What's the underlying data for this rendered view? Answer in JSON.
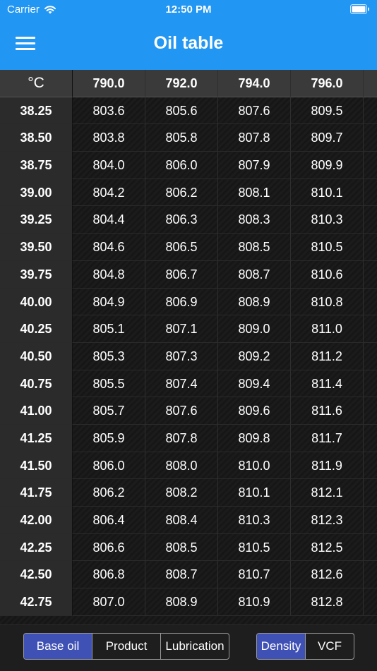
{
  "status": {
    "carrier": "Carrier",
    "time": "12:50 PM"
  },
  "header": {
    "title": "Oil table"
  },
  "table": {
    "corner": "°C",
    "columns": [
      "790.0",
      "792.0",
      "794.0",
      "796.0"
    ],
    "rows": [
      {
        "t": "38.25",
        "v": [
          "803.6",
          "805.6",
          "807.6",
          "809.5"
        ]
      },
      {
        "t": "38.50",
        "v": [
          "803.8",
          "805.8",
          "807.8",
          "809.7"
        ]
      },
      {
        "t": "38.75",
        "v": [
          "804.0",
          "806.0",
          "807.9",
          "809.9"
        ]
      },
      {
        "t": "39.00",
        "v": [
          "804.2",
          "806.2",
          "808.1",
          "810.1"
        ]
      },
      {
        "t": "39.25",
        "v": [
          "804.4",
          "806.3",
          "808.3",
          "810.3"
        ]
      },
      {
        "t": "39.50",
        "v": [
          "804.6",
          "806.5",
          "808.5",
          "810.5"
        ]
      },
      {
        "t": "39.75",
        "v": [
          "804.8",
          "806.7",
          "808.7",
          "810.6"
        ]
      },
      {
        "t": "40.00",
        "v": [
          "804.9",
          "806.9",
          "808.9",
          "810.8"
        ]
      },
      {
        "t": "40.25",
        "v": [
          "805.1",
          "807.1",
          "809.0",
          "811.0"
        ]
      },
      {
        "t": "40.50",
        "v": [
          "805.3",
          "807.3",
          "809.2",
          "811.2"
        ]
      },
      {
        "t": "40.75",
        "v": [
          "805.5",
          "807.4",
          "809.4",
          "811.4"
        ]
      },
      {
        "t": "41.00",
        "v": [
          "805.7",
          "807.6",
          "809.6",
          "811.6"
        ]
      },
      {
        "t": "41.25",
        "v": [
          "805.9",
          "807.8",
          "809.8",
          "811.7"
        ]
      },
      {
        "t": "41.50",
        "v": [
          "806.0",
          "808.0",
          "810.0",
          "811.9"
        ]
      },
      {
        "t": "41.75",
        "v": [
          "806.2",
          "808.2",
          "810.1",
          "812.1"
        ]
      },
      {
        "t": "42.00",
        "v": [
          "806.4",
          "808.4",
          "810.3",
          "812.3"
        ]
      },
      {
        "t": "42.25",
        "v": [
          "806.6",
          "808.5",
          "810.5",
          "812.5"
        ]
      },
      {
        "t": "42.50",
        "v": [
          "806.8",
          "808.7",
          "810.7",
          "812.6"
        ]
      },
      {
        "t": "42.75",
        "v": [
          "807.0",
          "808.9",
          "810.9",
          "812.8"
        ]
      }
    ]
  },
  "footer": {
    "oil_types": [
      {
        "label": "Base oil",
        "active": true
      },
      {
        "label": "Product",
        "active": false
      },
      {
        "label": "Lubrication",
        "active": false
      }
    ],
    "modes": [
      {
        "label": "Density",
        "active": true
      },
      {
        "label": "VCF",
        "active": false
      }
    ]
  },
  "colors": {
    "header_bg": "#2196f3",
    "active_segment": "#3f51b5"
  }
}
